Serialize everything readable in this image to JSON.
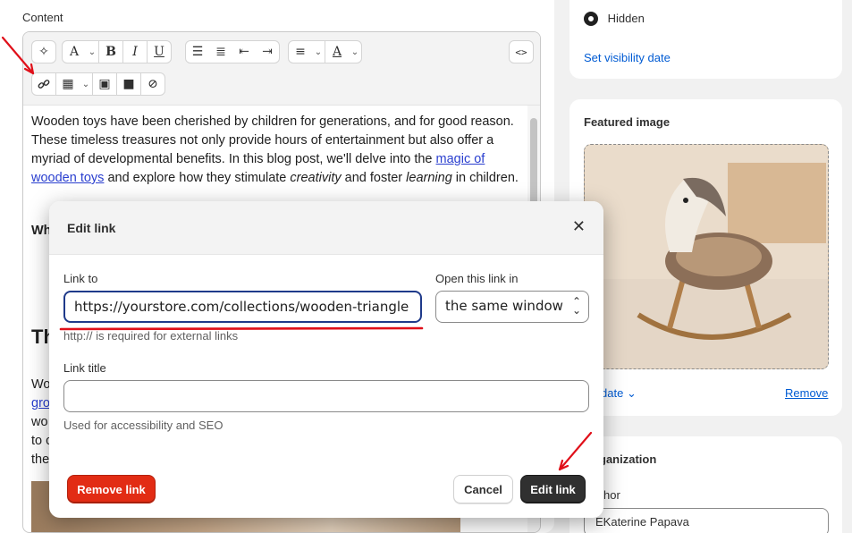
{
  "content": {
    "label": "Content",
    "paragraph1_a": "Wooden toys have been cherished by children for generations, and for good reason. These timeless treasures not only provide hours of entertainment but also offer a myriad of developmental benefits. In this blog post, we'll delve into the",
    "link_text": "magic of wooden toys",
    "paragraph1_b": "and explore how they stimulate",
    "italic_word": "creativity",
    "paragraph1_c": "and foster",
    "italic_word2": "learning",
    "paragraph1_d": "in children.",
    "partial_heading1": "Wh",
    "partial_heading2": "Th",
    "partial_lines": [
      "Wo",
      "gro",
      "wo",
      "to c",
      "the"
    ]
  },
  "sidebar": {
    "visibility_option": "Hidden",
    "visibility_link": "Set visibility date",
    "featured_title": "Featured image",
    "update_link": "date",
    "remove_link": "Remove",
    "organization_title": "ganization",
    "author_label": "hor",
    "author_value": "EKaterine Papava"
  },
  "modal": {
    "title": "Edit link",
    "link_to_label": "Link to",
    "link_to_value": "https://yourstore.com/collections/wooden-triangle",
    "link_help": "http:// is required for external links",
    "open_in_label": "Open this link in",
    "open_in_value": "the same window",
    "title_label": "Link title",
    "title_value": "",
    "title_help": "Used for accessibility and SEO",
    "remove_button": "Remove link",
    "cancel_button": "Cancel",
    "submit_button": "Edit link"
  },
  "icons": {
    "close": "close-icon",
    "link": "link-icon",
    "select_chevron": "chevron-updown-icon"
  },
  "colors": {
    "accent_link": "#005bd3",
    "danger": "#e22c14",
    "primary": "#303030",
    "annotation": "#e0101a"
  }
}
